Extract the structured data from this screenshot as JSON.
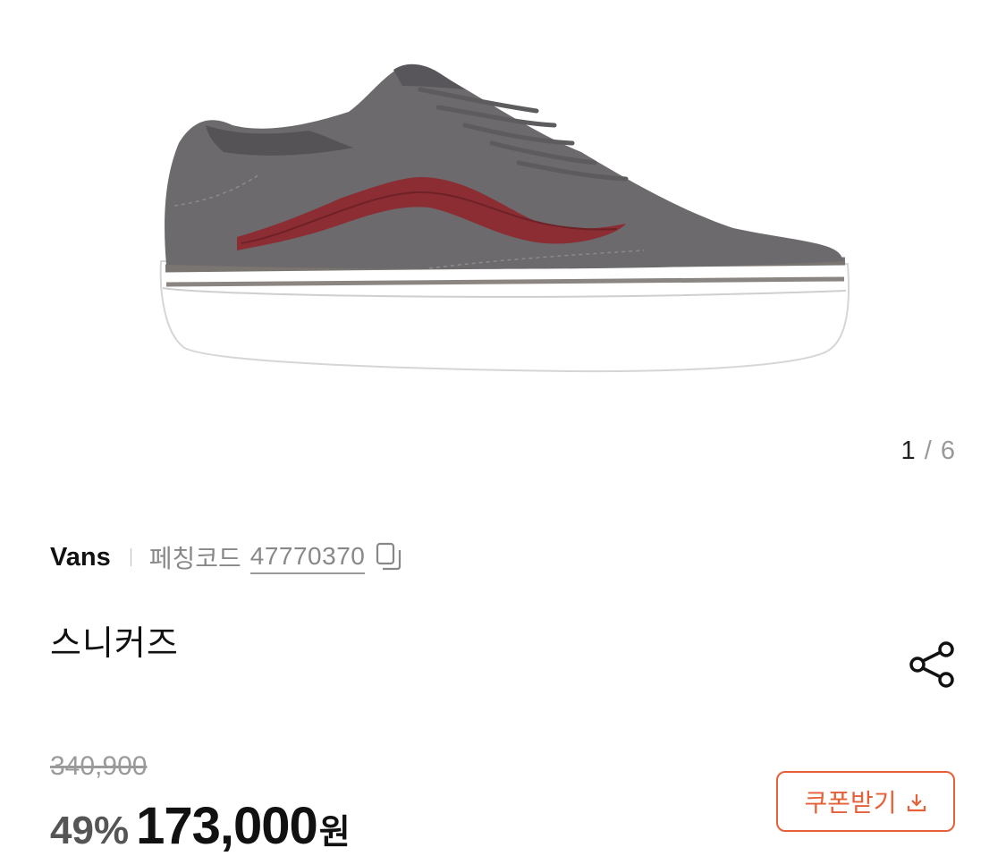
{
  "gallery": {
    "current": "1",
    "separator": "/",
    "total": "6"
  },
  "product": {
    "brand": "Vans",
    "code_label": "페칭코드",
    "code_value": "47770370",
    "name": "스니커즈"
  },
  "pricing": {
    "original": "340,900",
    "discount": "49%",
    "sale": "173,000",
    "currency": "원"
  },
  "actions": {
    "coupon_label": "쿠폰받기"
  },
  "icons": {
    "copy": "copy-icon",
    "share": "share-icon",
    "download": "download-icon"
  },
  "colors": {
    "accent": "#e6603a",
    "text": "#111111",
    "muted": "#888888"
  }
}
